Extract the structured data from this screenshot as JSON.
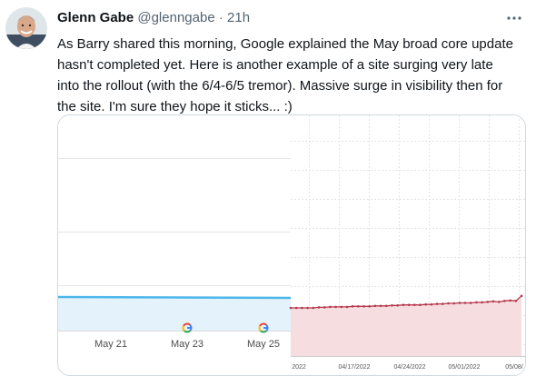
{
  "tweet": {
    "author_name": "Glenn Gabe",
    "handle": "@glenngabe",
    "separator": "·",
    "time": "21h",
    "text_lines": [
      "As Barry shared this morning, Google explained the May broad core update",
      "hasn't completed yet. Here is another example of a site surging very late",
      "into the rollout (with the 6/4-6/5 tremor). Massive surge in visibility then for",
      "the site. I'm sure they hope it sticks... :)"
    ]
  },
  "icons": {
    "more": "more-horizontal-icon",
    "avatar": "avatar-photo",
    "google_marker": "google-g-icon"
  },
  "colors": {
    "text": "#0f1419",
    "secondary": "#536471",
    "left_line": "#4db6ea",
    "left_fill": "#e4f3fb",
    "right_line": "#b5394d",
    "right_fill": "#f6dde0"
  },
  "chart_data": [
    {
      "type": "area",
      "x_ticks": [
        "May 21",
        "May 23",
        "May 25"
      ],
      "markers": [
        "May 23",
        "May 25"
      ],
      "note": "flat visibility line near bottom of panel"
    },
    {
      "type": "line",
      "x_ticks": [
        "2022",
        "04/17/2022",
        "04/24/2022",
        "05/01/2022",
        "05/08/"
      ],
      "values": [
        1.0,
        1.0,
        1.0,
        1.0,
        1.0,
        1.01,
        1.01,
        1.02,
        1.02,
        1.02,
        1.02,
        1.03,
        1.03,
        1.03,
        1.03,
        1.04,
        1.04,
        1.04,
        1.05,
        1.05,
        1.06,
        1.06,
        1.06,
        1.06,
        1.07,
        1.07,
        1.08,
        1.08,
        1.09,
        1.09,
        1.1,
        1.1,
        1.1,
        1.11,
        1.11,
        1.12,
        1.13,
        1.12,
        1.14,
        1.15,
        1.14,
        1.24
      ]
    }
  ]
}
